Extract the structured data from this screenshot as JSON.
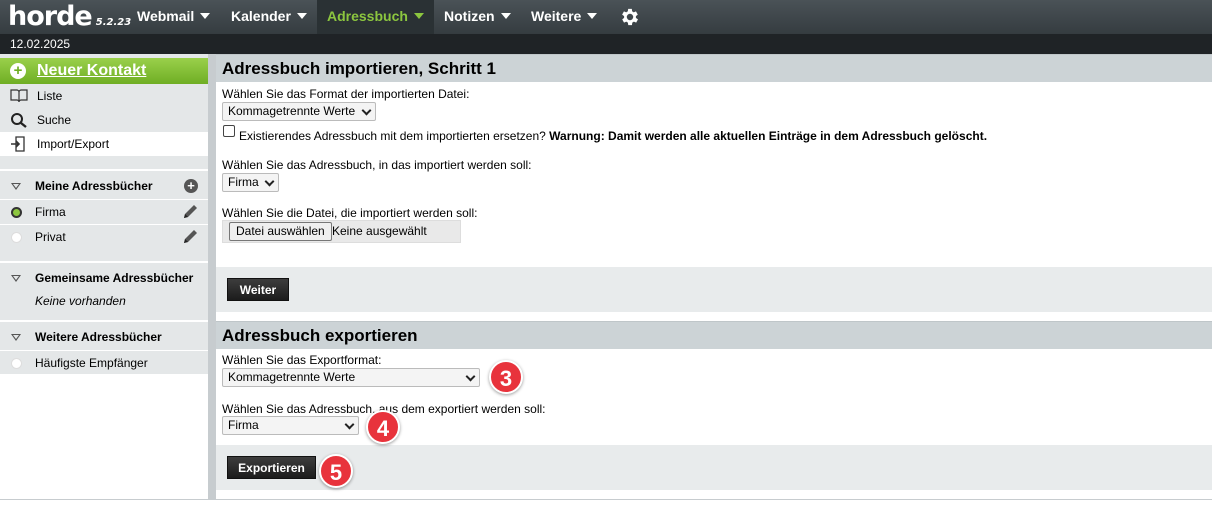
{
  "app": {
    "logo": "horde",
    "version": "5.2.23",
    "date": "12.02.2025"
  },
  "menu": [
    {
      "label": "Webmail"
    },
    {
      "label": "Kalender"
    },
    {
      "label": "Adressbuch"
    },
    {
      "label": "Notizen"
    },
    {
      "label": "Weitere"
    }
  ],
  "sidebar": {
    "new_contact": "Neuer Kontakt",
    "links": [
      {
        "label": "Liste"
      },
      {
        "label": "Suche"
      },
      {
        "label": "Import/Export"
      }
    ],
    "my_books": {
      "title": "Meine Adressbücher",
      "items": [
        {
          "label": "Firma",
          "selected": true
        },
        {
          "label": "Privat",
          "selected": false
        }
      ]
    },
    "shared_books": {
      "title": "Gemeinsame Adressbücher",
      "empty": "Keine vorhanden"
    },
    "other_books": {
      "title": "Weitere Adressbücher",
      "items": [
        {
          "label": "Häufigste Empfänger"
        }
      ]
    }
  },
  "import": {
    "title": "Adressbuch importieren, Schritt 1",
    "format_label": "Wählen Sie das Format der importierten Datei:",
    "format_value": "Kommagetrennte Werte",
    "replace_label": "Existierendes Adressbuch mit dem importierten ersetzen?",
    "replace_warning": "Warnung: Damit werden alle aktuellen Einträge in dem Adressbuch gelöscht.",
    "book_label": "Wählen Sie das Adressbuch, in das importiert werden soll:",
    "book_value": "Firma",
    "file_label": "Wählen Sie die Datei, die importiert werden soll:",
    "file_button": "Datei auswählen",
    "file_none": "Keine ausgewählt",
    "next_button": "Weiter"
  },
  "export": {
    "title": "Adressbuch exportieren",
    "format_label": "Wählen Sie das Exportformat:",
    "format_value": "Kommagetrennte Werte",
    "book_label": "Wählen Sie das Adressbuch, aus dem exportiert werden soll:",
    "book_value": "Firma",
    "export_button": "Exportieren"
  },
  "badges": [
    "3",
    "4",
    "5"
  ],
  "colors": {
    "accent_green": "#8cc63f",
    "badge_red": "#e8333c",
    "topbar": "#353c40"
  }
}
